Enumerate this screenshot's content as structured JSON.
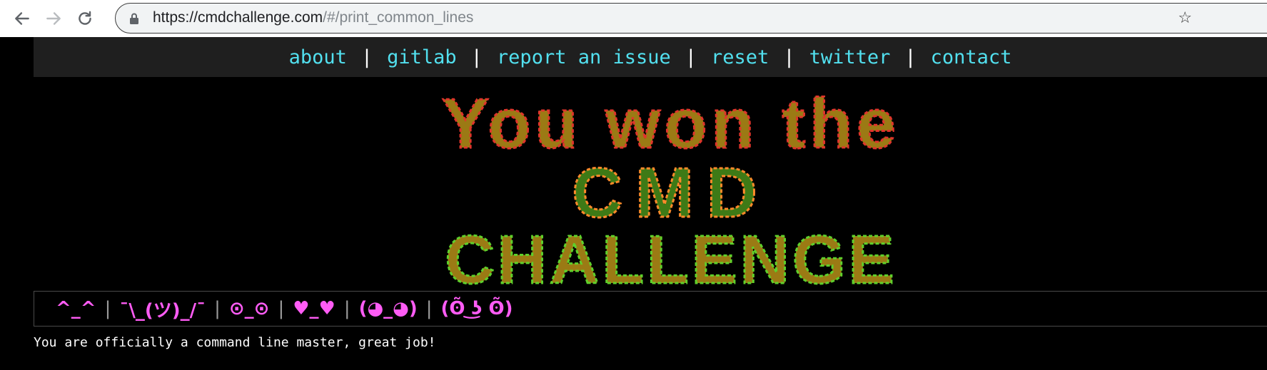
{
  "browser": {
    "url_host": "https://cmdchallenge.com",
    "url_path": "/#/print_common_lines"
  },
  "navbar": {
    "links": [
      "about",
      "gitlab",
      "report an issue",
      "reset",
      "twitter",
      "contact"
    ]
  },
  "banner": {
    "lines": [
      "You won the",
      "CMD",
      "CHALLENGE"
    ]
  },
  "emoticons": [
    "^_^",
    "¯\\_(ツ)_/¯",
    "⊙_⊙",
    "♥_♥",
    "(◕_◕)",
    "(ʘ̃ ͜ʖ ʘ̃)"
  ],
  "status_message": "You are officially a command line master, great job!",
  "colors": {
    "link": "#52e0ef",
    "emoticon": "#ff5cf5",
    "banner_red": "#e0352b",
    "banner_orange": "#ff8a2a",
    "banner_yellow": "#e9c01a",
    "banner_green": "#5fd02b"
  }
}
